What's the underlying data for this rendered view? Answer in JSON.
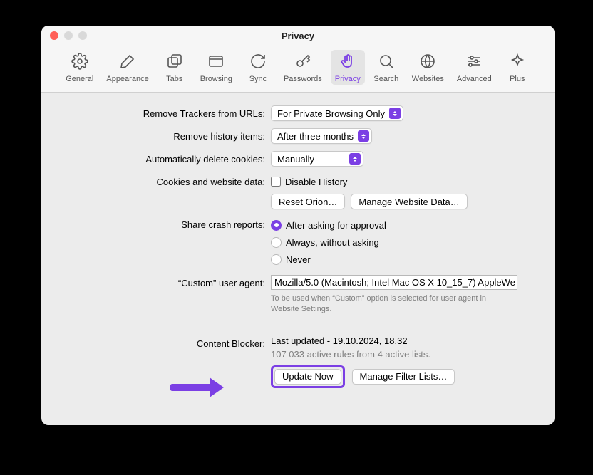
{
  "window_title": "Privacy",
  "toolbar": [
    {
      "icon": "gear",
      "label": "General"
    },
    {
      "icon": "brush",
      "label": "Appearance"
    },
    {
      "icon": "tabs",
      "label": "Tabs"
    },
    {
      "icon": "window",
      "label": "Browsing"
    },
    {
      "icon": "sync",
      "label": "Sync"
    },
    {
      "icon": "key",
      "label": "Passwords"
    },
    {
      "icon": "hand",
      "label": "Privacy",
      "active": true
    },
    {
      "icon": "search",
      "label": "Search"
    },
    {
      "icon": "globe",
      "label": "Websites"
    },
    {
      "icon": "sliders",
      "label": "Advanced"
    },
    {
      "icon": "sparkle",
      "label": "Plus"
    }
  ],
  "labels": {
    "remove_trackers": "Remove Trackers from URLs:",
    "remove_history": "Remove history items:",
    "auto_delete_cookies": "Automatically delete cookies:",
    "cookies_data": "Cookies and website data:",
    "crash_reports": "Share crash reports:",
    "user_agent": "“Custom” user agent:",
    "content_blocker": "Content Blocker:"
  },
  "values": {
    "remove_trackers": "For Private Browsing Only",
    "remove_history": "After three months",
    "auto_delete_cookies": "Manually",
    "disable_history": "Disable History",
    "reset_orion": "Reset Orion…",
    "manage_website_data": "Manage Website Data…",
    "crash_options": [
      "After asking for approval",
      "Always, without asking",
      "Never"
    ],
    "crash_selected_index": 0,
    "user_agent_value": "Mozilla/5.0 (Macintosh; Intel Mac OS X 10_15_7) AppleWe",
    "user_agent_help": "To be used when “Custom” option is selected for user agent in Website Settings.",
    "cb_last_updated": "Last updated - 19.10.2024, 18.32",
    "cb_rules": "107 033 active rules from 4 active lists.",
    "update_now": "Update Now",
    "manage_filters": "Manage Filter Lists…"
  }
}
